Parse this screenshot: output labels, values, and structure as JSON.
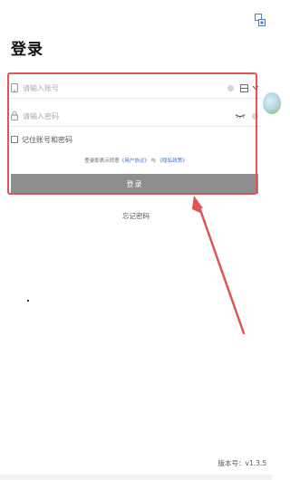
{
  "header": {
    "title": "登录"
  },
  "form": {
    "account_placeholder": "请输入账号",
    "password_placeholder": "请输入密码",
    "remember_label": "记住账号和密码",
    "agreement": {
      "prefix": "登录即表示同意",
      "user_agreement": "《用户协议》",
      "connector": "与",
      "privacy_policy": "《隐私政策》"
    },
    "login_label": "登录"
  },
  "footer": {
    "forgot_label": "忘记密码",
    "version": "版本号：v1.3.5"
  },
  "colors": {
    "highlight": "#e05454",
    "button": "#8e8e8e",
    "link": "#3a6fd8"
  },
  "icons": [
    "qr-scan-icon",
    "phone-icon",
    "lock-icon",
    "clear-icon",
    "save-icon",
    "chevron-down-icon",
    "eye-closed-icon",
    "checkbox-icon"
  ]
}
